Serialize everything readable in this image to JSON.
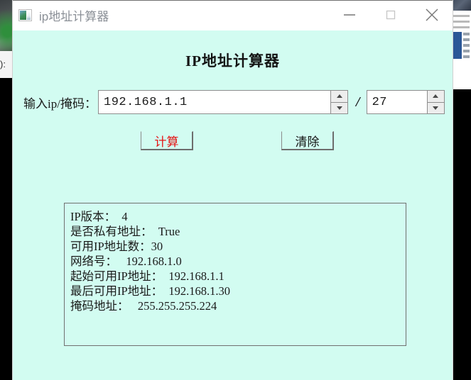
{
  "window": {
    "title": "ip地址计算器",
    "icon": "app-window-image-icon",
    "controls": {
      "minimize": "—",
      "maximize": "□",
      "close": "✕"
    },
    "colors": {
      "client_background": "#d2fcf1",
      "titlebar_background": "#ffffff",
      "title_text": "#8a8f96",
      "accent_calculate": "#e51212",
      "field_border": "#8d8d8d",
      "box_border": "#707070"
    }
  },
  "main": {
    "heading": "IP地址计算器",
    "form": {
      "ip_label": "输入ip/掩码：",
      "ip_value": "192.168.1.1",
      "ip_placeholder": "192.168.1.1",
      "separator": "/",
      "mask_value": "27",
      "mask_placeholder": "27",
      "spin_up_icon": "triangle-up-icon",
      "spin_down_icon": "triangle-down-icon"
    },
    "buttons": {
      "calculate": "计算",
      "clear": "清除"
    },
    "results": [
      "IP版本：  4",
      "是否私有地址：  True",
      "可用IP地址数：30",
      "网络号：   192.168.1.0",
      "起始可用IP地址：  192.168.1.1",
      "最后可用IP地址：  192.168.1.30",
      "掩码地址：   255.255.255.224"
    ]
  },
  "desktop": {
    "left_strip_text": "):"
  }
}
